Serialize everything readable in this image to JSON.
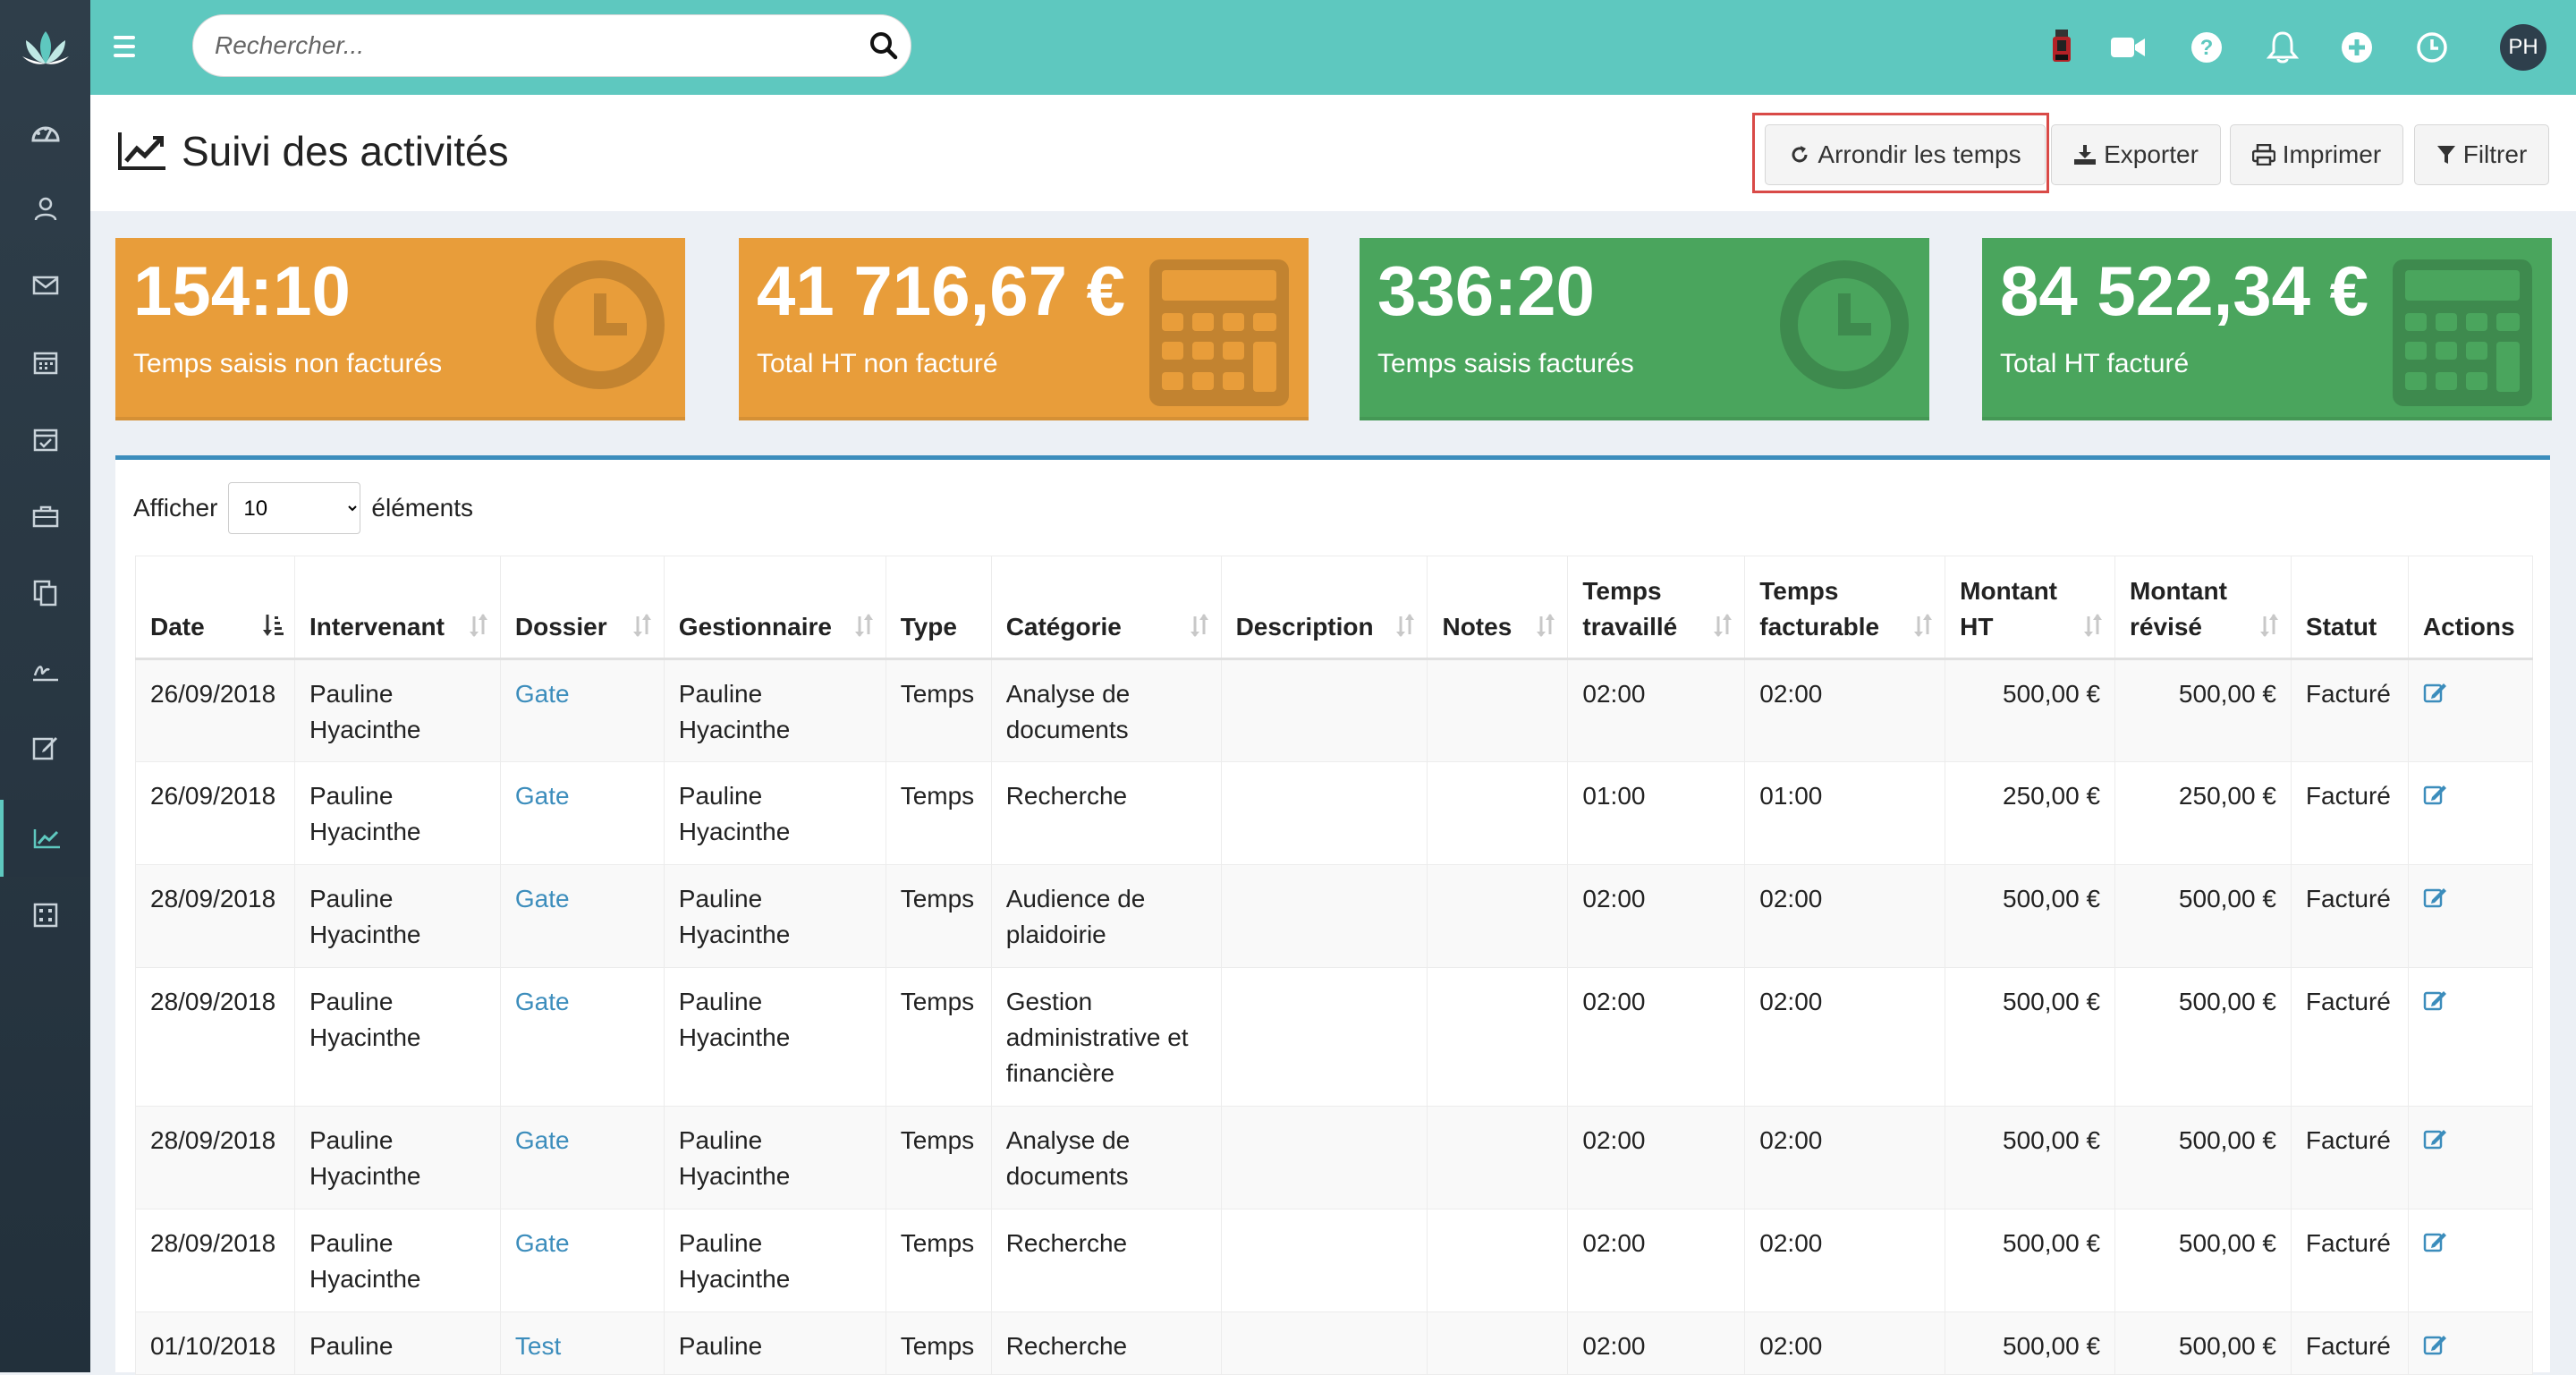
{
  "search": {
    "placeholder": "Rechercher..."
  },
  "topbar": {
    "avatar_initials": "PH"
  },
  "page": {
    "title": "Suivi des activités"
  },
  "actions": {
    "round": "Arrondir les temps",
    "export": "Exporter",
    "print": "Imprimer",
    "filter": "Filtrer"
  },
  "kpis": [
    {
      "value": "154:10",
      "label": "Temps saisis non facturés",
      "color": "#e89d3a",
      "icon": "clock-icon"
    },
    {
      "value": "41 716,67 €",
      "label": "Total HT non facturé",
      "color": "#e89d3a",
      "icon": "calculator-icon"
    },
    {
      "value": "336:20",
      "label": "Temps saisis facturés",
      "color": "#4aa55d",
      "icon": "clock-icon"
    },
    {
      "value": "84 522,34 €",
      "label": "Total HT facturé",
      "color": "#4aa55d",
      "icon": "calculator-icon"
    }
  ],
  "table": {
    "length_prefix": "Afficher",
    "length_value": "10",
    "length_suffix": "éléments",
    "columns": [
      {
        "line1": "",
        "line2": "Date"
      },
      {
        "line1": "",
        "line2": "Intervenant"
      },
      {
        "line1": "",
        "line2": "Dossier"
      },
      {
        "line1": "",
        "line2": "Gestionnaire"
      },
      {
        "line1": "",
        "line2": "Type"
      },
      {
        "line1": "",
        "line2": "Catégorie"
      },
      {
        "line1": "",
        "line2": "Description"
      },
      {
        "line1": "",
        "line2": "Notes"
      },
      {
        "line1": "Temps",
        "line2": "travaillé"
      },
      {
        "line1": "Temps",
        "line2": "facturable"
      },
      {
        "line1": "Montant",
        "line2": "HT"
      },
      {
        "line1": "Montant",
        "line2": "révisé"
      },
      {
        "line1": "",
        "line2": "Statut"
      },
      {
        "line1": "",
        "line2": "Actions"
      }
    ],
    "rows": [
      {
        "date": "26/09/2018",
        "intervenant": [
          "Pauline",
          "Hyacinthe"
        ],
        "dossier": "Gate",
        "gestionnaire": [
          "Pauline",
          "Hyacinthe"
        ],
        "type": "Temps",
        "categorie": [
          "Analyse de",
          "documents"
        ],
        "description": "",
        "notes": "",
        "temps_travaille": "02:00",
        "temps_facturable": "02:00",
        "montant_ht": "500,00 €",
        "montant_revise": "500,00 €",
        "statut": "Facturé"
      },
      {
        "date": "26/09/2018",
        "intervenant": [
          "Pauline",
          "Hyacinthe"
        ],
        "dossier": "Gate",
        "gestionnaire": [
          "Pauline",
          "Hyacinthe"
        ],
        "type": "Temps",
        "categorie": [
          "Recherche"
        ],
        "description": "",
        "notes": "",
        "temps_travaille": "01:00",
        "temps_facturable": "01:00",
        "montant_ht": "250,00 €",
        "montant_revise": "250,00 €",
        "statut": "Facturé"
      },
      {
        "date": "28/09/2018",
        "intervenant": [
          "Pauline",
          "Hyacinthe"
        ],
        "dossier": "Gate",
        "gestionnaire": [
          "Pauline",
          "Hyacinthe"
        ],
        "type": "Temps",
        "categorie": [
          "Audience de",
          "plaidoirie"
        ],
        "description": "",
        "notes": "",
        "temps_travaille": "02:00",
        "temps_facturable": "02:00",
        "montant_ht": "500,00 €",
        "montant_revise": "500,00 €",
        "statut": "Facturé"
      },
      {
        "date": "28/09/2018",
        "intervenant": [
          "Pauline",
          "Hyacinthe"
        ],
        "dossier": "Gate",
        "gestionnaire": [
          "Pauline",
          "Hyacinthe"
        ],
        "type": "Temps",
        "categorie": [
          "Gestion",
          "administrative et",
          "financière"
        ],
        "description": "",
        "notes": "",
        "temps_travaille": "02:00",
        "temps_facturable": "02:00",
        "montant_ht": "500,00 €",
        "montant_revise": "500,00 €",
        "statut": "Facturé"
      },
      {
        "date": "28/09/2018",
        "intervenant": [
          "Pauline",
          "Hyacinthe"
        ],
        "dossier": "Gate",
        "gestionnaire": [
          "Pauline",
          "Hyacinthe"
        ],
        "type": "Temps",
        "categorie": [
          "Analyse de",
          "documents"
        ],
        "description": "",
        "notes": "",
        "temps_travaille": "02:00",
        "temps_facturable": "02:00",
        "montant_ht": "500,00 €",
        "montant_revise": "500,00 €",
        "statut": "Facturé"
      },
      {
        "date": "28/09/2018",
        "intervenant": [
          "Pauline",
          "Hyacinthe"
        ],
        "dossier": "Gate",
        "gestionnaire": [
          "Pauline",
          "Hyacinthe"
        ],
        "type": "Temps",
        "categorie": [
          "Recherche"
        ],
        "description": "",
        "notes": "",
        "temps_travaille": "02:00",
        "temps_facturable": "02:00",
        "montant_ht": "500,00 €",
        "montant_revise": "500,00 €",
        "statut": "Facturé"
      },
      {
        "date": "01/10/2018",
        "intervenant": [
          "Pauline"
        ],
        "dossier": "Test",
        "gestionnaire": [
          "Pauline"
        ],
        "type": "Temps",
        "categorie": [
          "Recherche"
        ],
        "description": "",
        "notes": "",
        "temps_travaille": "02:00",
        "temps_facturable": "02:00",
        "montant_ht": "500,00 €",
        "montant_revise": "500,00 €",
        "statut": "Facturé"
      }
    ]
  }
}
